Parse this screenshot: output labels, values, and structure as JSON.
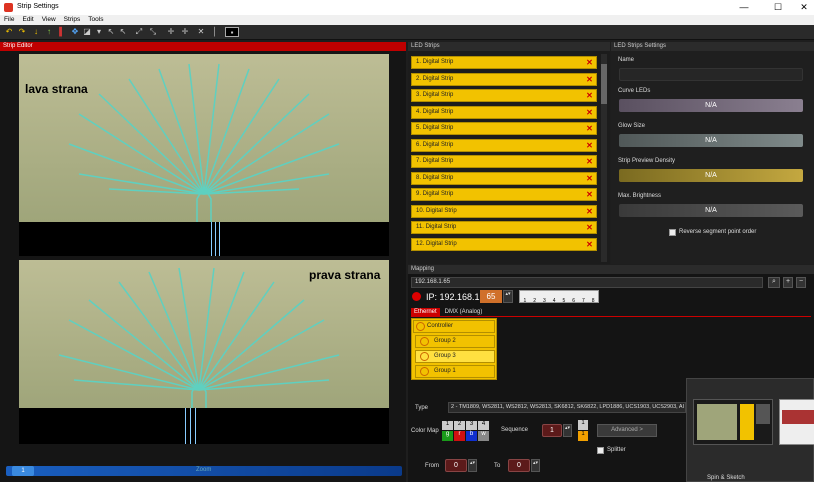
{
  "window": {
    "title": "Strip Settings",
    "minimize": "—",
    "maximize": "☐",
    "close": "✕"
  },
  "menu": [
    "File",
    "Edit",
    "View",
    "Strips",
    "Tools"
  ],
  "editor": {
    "title": "Strip Editor",
    "label_top": "lava strana",
    "label_bottom": "prava strana",
    "zoom_label": "Zoom",
    "zoom_value": "1"
  },
  "led_strips": {
    "title": "LED Strips",
    "items": [
      "1. Digital Strip",
      "2. Digital Strip",
      "3. Digital Strip",
      "4. Digital Strip",
      "5. Digital Strip",
      "6. Digital Strip",
      "7. Digital Strip",
      "8. Digital Strip",
      "9. Digital Strip",
      "10. Digital Strip",
      "11. Digital Strip",
      "12. Digital Strip"
    ],
    "remove_glyph": "✕"
  },
  "strip_settings": {
    "title": "LED Strips Settings",
    "name_label": "Name",
    "name_value": "",
    "curve_label": "Curve LEDs",
    "curve_value": "N/A",
    "glow_label": "Glow Size",
    "glow_value": "N/A",
    "density_label": "Strip Preview Density",
    "density_value": "N/A",
    "brightness_label": "Max. Brightness",
    "brightness_value": "N/A",
    "reverse_label": "Reverse segment point order",
    "accent": "#f2c200"
  },
  "mapping": {
    "title": "Mapping",
    "ip_select": "192.168.1.65",
    "ip_prefix": "IP: 192.168.1.",
    "ip_last": "65",
    "dip_numbers": [
      "1",
      "2",
      "3",
      "4",
      "5",
      "6",
      "7",
      "8"
    ],
    "tabs": [
      "Ethernet",
      "DMX (Analog)"
    ],
    "groups": [
      "Controller",
      "Group 2",
      "Group 3",
      "Group 1"
    ],
    "type_label": "Type",
    "type_value": "2 - TM1809, WS2811, WS2812, WS2813, SK6812, SK6822, LPD1886, UCS1903, UCS2903, AI",
    "color_map_label": "Color Map",
    "color_map_numbers": [
      "1",
      "2",
      "3",
      "4"
    ],
    "color_map_channels": [
      "g",
      "r",
      "b",
      "w"
    ],
    "sequence_label": "Sequence",
    "sequence_value": "1",
    "seq_side": [
      "1",
      "1"
    ],
    "advanced_label": "Advanced >",
    "splitter_label": "Splitter",
    "from_label": "From",
    "from_value": "0",
    "to_label": "To",
    "to_value": "0"
  },
  "taskbar_thumb": {
    "caption": "Spin & Sketch"
  }
}
